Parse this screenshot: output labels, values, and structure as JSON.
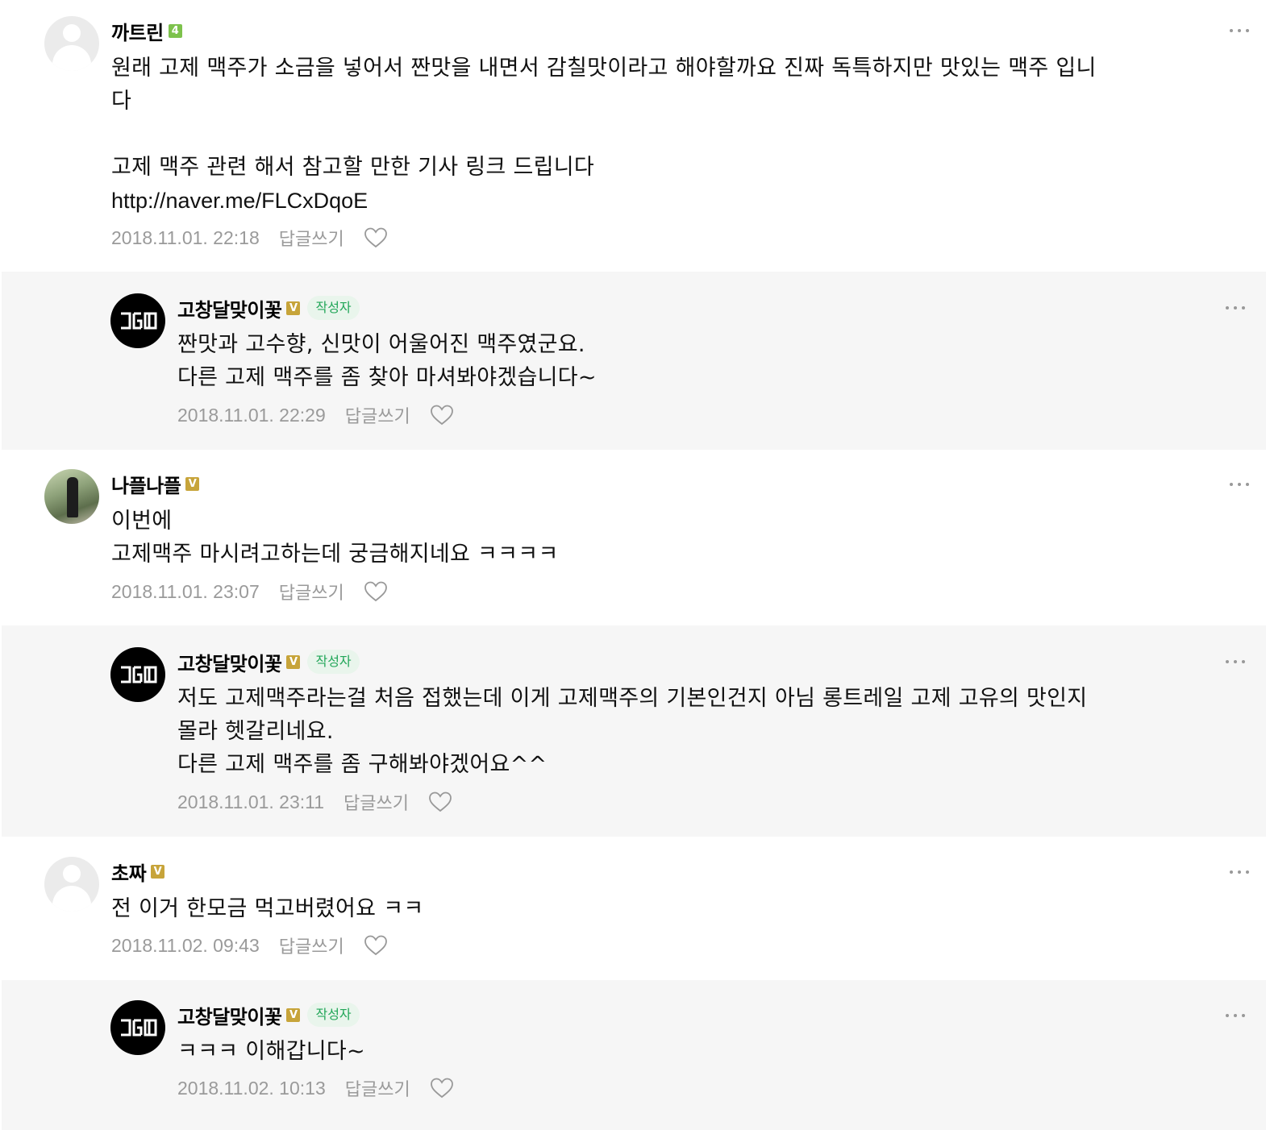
{
  "comments": [
    {
      "nickname": "까트린",
      "level_badge": "4",
      "text": "원래 고제 맥주가 소금을 넣어서 짠맛을 내면서 감칠맛이라고 해야할까요 진짜 독특하지만 맛있는 맥주 입니\n다\n\n고제 맥주 관련 해서 참고할 만한 기사 링크 드립니다",
      "link": "http://naver.me/FLCxDqoE",
      "date": "2018.11.01. 22:18",
      "reply_label": "답글쓰기",
      "avatar": "default-profile-icon"
    },
    {
      "nickname": "고창달맞이꽃",
      "level_badge": "V",
      "author_badge": "작성자",
      "text": "짠맛과 고수향, 신맛이 어울어진 맥주였군요.\n다른 고제 맥주를 좀 찾아 마셔봐야겠습니다~",
      "date": "2018.11.01. 22:29",
      "reply_label": "답글쓰기",
      "avatar": "gdl-logo"
    },
    {
      "nickname": "나플나플",
      "level_badge": "V",
      "text": "이번에\n고제맥주 마시려고하는데 궁금해지네요 ㅋㅋㅋㅋ",
      "date": "2018.11.01. 23:07",
      "reply_label": "답글쓰기",
      "avatar": "user-photo"
    },
    {
      "nickname": "고창달맞이꽃",
      "level_badge": "V",
      "author_badge": "작성자",
      "text": "저도 고제맥주라는걸 처음 접했는데 이게 고제맥주의 기본인건지 아님 롱트레일 고제 고유의 맛인지\n몰라 헷갈리네요.\n다른 고제 맥주를 좀 구해봐야겠어요^^",
      "date": "2018.11.01. 23:11",
      "reply_label": "답글쓰기",
      "avatar": "gdl-logo"
    },
    {
      "nickname": "초짜",
      "level_badge": "V",
      "text": "전 이거 한모금 먹고버렸어요 ㅋㅋ",
      "date": "2018.11.02. 09:43",
      "reply_label": "답글쓰기",
      "avatar": "default-profile-icon"
    },
    {
      "nickname": "고창달맞이꽃",
      "level_badge": "V",
      "author_badge": "작성자",
      "text": "ㅋㅋㅋ 이해갑니다~",
      "date": "2018.11.02. 10:13",
      "reply_label": "답글쓰기",
      "avatar": "gdl-logo"
    }
  ],
  "colors": {
    "reply_background": "#f6f6f6",
    "author_badge_text": "#21a658",
    "author_badge_bg": "#e9f5ec",
    "level_green": "#7dc24c",
    "level_gold": "#c7a43a",
    "meta_text": "#9a9a9a"
  }
}
